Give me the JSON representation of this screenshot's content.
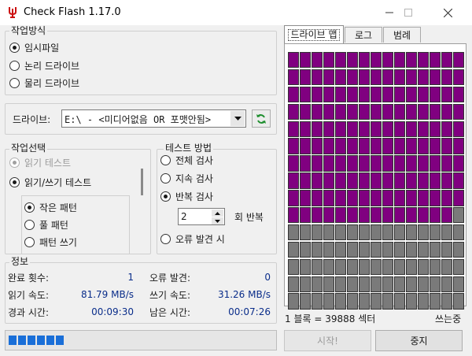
{
  "window": {
    "title": "Check Flash 1.17.0"
  },
  "mode": {
    "legend": "작업방식",
    "options": [
      "임시파일",
      "논리 드라이브",
      "물리 드라이브"
    ]
  },
  "drive": {
    "label": "드라이브:",
    "value": "E:\\ - <미디어없음 OR 포맷안됨>"
  },
  "action": {
    "legend": "작업선택",
    "read_test": "읽기 테스트",
    "rw_test": "읽기/쓰기 테스트",
    "patterns": [
      "작은 패턴",
      "풀 패턴",
      "패턴 쓰기"
    ]
  },
  "test_method": {
    "legend": "테스트 방법",
    "full": "전체 검사",
    "continuous": "지속 검사",
    "repeat": "반복 검사",
    "repeat_count": "2",
    "repeat_suffix": "회 반복",
    "until_error": "오류 발견 시"
  },
  "info": {
    "legend": "정보",
    "passes_label": "완료 횟수:",
    "passes": "1",
    "errors_label": "오류 발견:",
    "errors": "0",
    "read_speed_label": "읽기 속도:",
    "read_speed": "81.79 MB/s",
    "write_speed_label": "쓰기 속도:",
    "write_speed": "31.26 MB/s",
    "elapsed_label": "경과 시간:",
    "elapsed": "00:09:30",
    "remaining_label": "남은 시간:",
    "remaining": "00:07:26"
  },
  "tabs": [
    "드라이브 맵",
    "로그",
    "범례"
  ],
  "map": {
    "block_info": "1 블록 = 39888 섹터",
    "status": "쓰는중"
  },
  "buttons": {
    "start": "시작!",
    "stop": "중지"
  },
  "progress": {
    "segments": 6
  },
  "colors": {
    "written": "#800080",
    "empty": "#7a7a7a",
    "progress": "#1a6fd8"
  }
}
